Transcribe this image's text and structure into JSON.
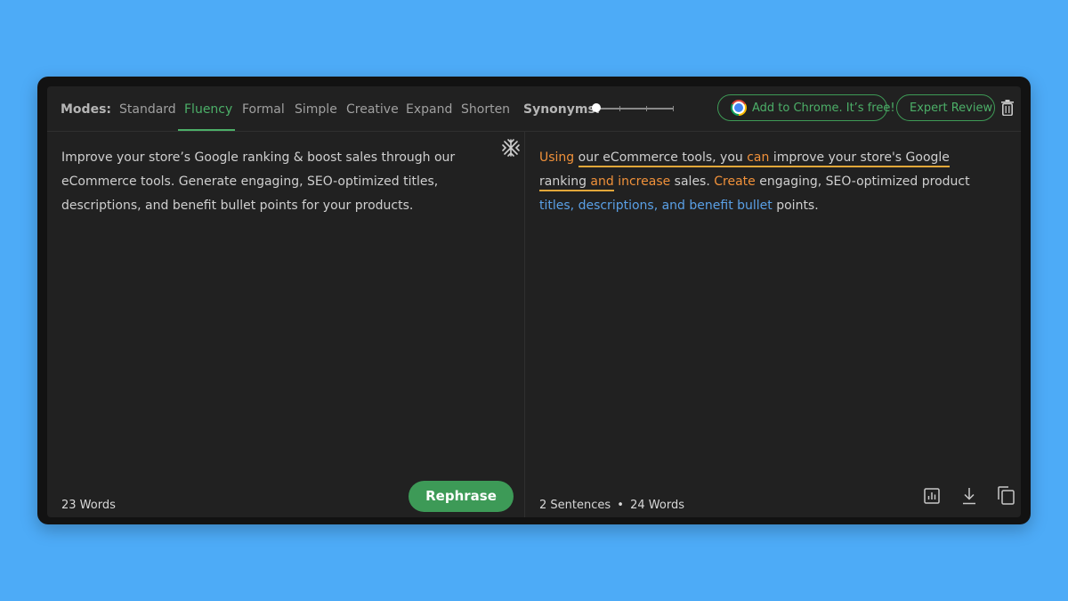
{
  "toolbar": {
    "modes_label": "Modes:",
    "modes": [
      "Standard",
      "Fluency",
      "Formal",
      "Simple",
      "Creative",
      "Expand",
      "Shorten"
    ],
    "active_mode": "Fluency",
    "synonyms_label": "Synonyms:",
    "synonyms_level": 0,
    "chrome_button": "Add to Chrome. It’s free!",
    "expert_button": "Expert Review"
  },
  "input": {
    "text": "Improve your store’s Google ranking & boost sales through our eCommerce tools. Generate engaging, SEO-optimized titles, descriptions, and benefit bullet points for your products.",
    "word_count": "23 Words"
  },
  "rephrase_button": "Rephrase",
  "output": {
    "segments": [
      {
        "text": "Using",
        "style": "changed"
      },
      {
        "text": " ",
        "style": "plain"
      },
      {
        "text": "our eCommerce tools, you ",
        "style": "structure"
      },
      {
        "text": "can",
        "style": "changed-structure"
      },
      {
        "text": " improve your store's Google ranking ",
        "style": "structure"
      },
      {
        "text": "and",
        "style": "changed-structure"
      },
      {
        "text": " ",
        "style": "plain"
      },
      {
        "text": "increase",
        "style": "changed"
      },
      {
        "text": " sales. ",
        "style": "plain"
      },
      {
        "text": "Create",
        "style": "changed"
      },
      {
        "text": " engaging, SEO-optimized product ",
        "style": "plain"
      },
      {
        "text": "titles, descriptions, and benefit bullet",
        "style": "synonym"
      },
      {
        "text": " points.",
        "style": "plain"
      }
    ],
    "sentence_count": "2 Sentences",
    "separator": "•",
    "word_count": "24 Words"
  },
  "colors": {
    "accent": "#4caf68",
    "changed": "#f0913a",
    "synonym": "#5aa0e6",
    "structure_underline": "#e2a73a",
    "background": "#4dabf7"
  }
}
